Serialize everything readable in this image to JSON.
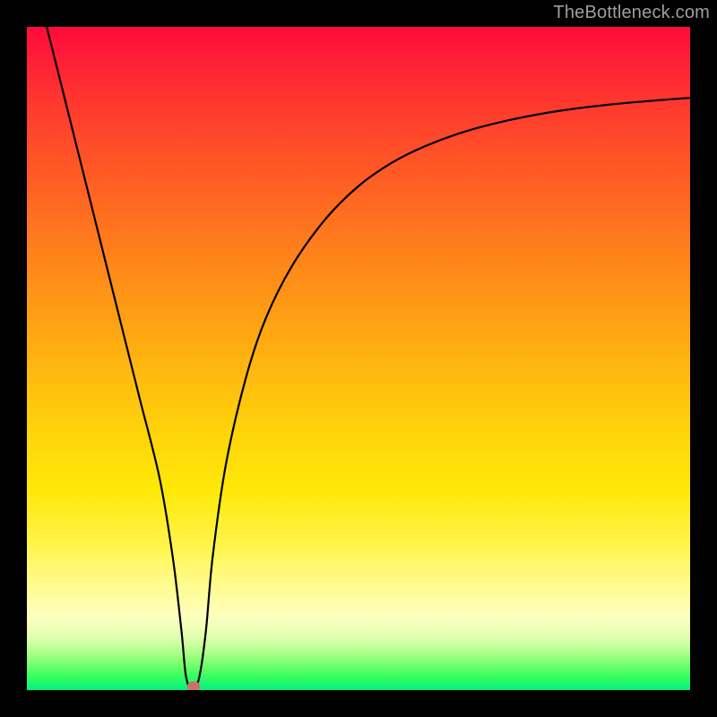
{
  "watermark": "TheBottleneck.com",
  "chart_data": {
    "type": "line",
    "title": "",
    "xlabel": "",
    "ylabel": "",
    "xlim": [
      0,
      100
    ],
    "ylim": [
      0,
      100
    ],
    "grid": false,
    "legend": false,
    "series": [
      {
        "name": "bottleneck-curve",
        "x": [
          3,
          5,
          8,
          11,
          14,
          17,
          20,
          22,
          23.3,
          24,
          25,
          26,
          27,
          28,
          30,
          33,
          36,
          40,
          45,
          50,
          55,
          60,
          66,
          73,
          80,
          88,
          96,
          100
        ],
        "y": [
          100,
          92,
          80,
          68,
          56,
          44,
          32,
          20,
          9,
          2,
          0,
          2,
          9,
          20,
          34,
          47,
          56,
          64,
          71,
          76,
          79.5,
          82,
          84.2,
          86,
          87.3,
          88.3,
          89,
          89.3
        ]
      }
    ],
    "marker": {
      "x": 25.2,
      "y": 0.5
    },
    "background_gradient": {
      "stops": [
        {
          "pos": 0,
          "color": "#ff0a3a"
        },
        {
          "pos": 50,
          "color": "#ffb90f"
        },
        {
          "pos": 80,
          "color": "#fff44a"
        },
        {
          "pos": 100,
          "color": "#05ee7f"
        }
      ]
    }
  }
}
